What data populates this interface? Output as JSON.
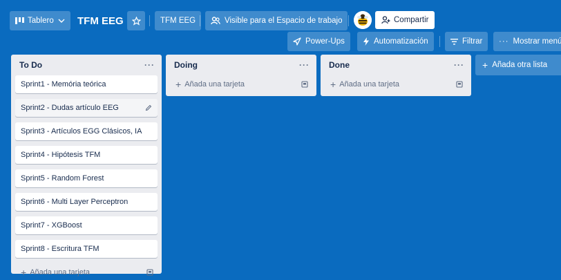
{
  "header": {
    "board_switcher": {
      "label": "Tablero"
    },
    "board_title": "TFM EEG",
    "workspace_chip": "TFM EEG",
    "visibility": "Visible para el Espacio de trabajo",
    "share_label": "Compartir"
  },
  "toolbar": {
    "powerups": "Power-Ups",
    "automation": "Automatización",
    "filter": "Filtrar",
    "show_menu": "Mostrar menú"
  },
  "lists": [
    {
      "title": "To Do",
      "menu": "···",
      "cards": [
        "Sprint1 - Memória teórica",
        "Sprint2 - Dudas artículo EEG",
        "Sprint3 - Artículos EGG Clásicos, IA",
        "Sprint4 - Hipótesis TFM",
        "Sprint5 - Random Forest",
        "Sprint6 - Multi Layer Perceptron",
        "Sprint7 - XGBoost",
        "Sprint8 - Escritura TFM"
      ],
      "add_card": "Añada una tarjeta"
    },
    {
      "title": "Doing",
      "menu": "···",
      "cards": [],
      "add_card": "Añada una tarjeta"
    },
    {
      "title": "Done",
      "menu": "···",
      "cards": [],
      "add_card": "Añada una tarjeta"
    }
  ],
  "add_list": "Añada otra lista",
  "colors": {
    "board_bg": "#0a6bbf",
    "list_bg": "#ebecf0",
    "card_bg": "#ffffff",
    "text": "#172b4d",
    "muted": "#5e6c84"
  }
}
